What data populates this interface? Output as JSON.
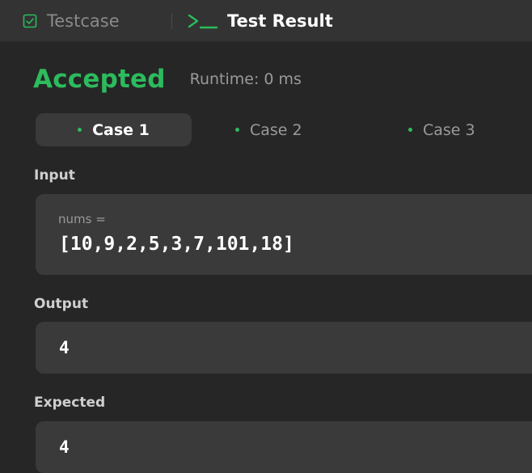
{
  "tabs": {
    "testcase_label": "Testcase",
    "testcase_icon": "checkbox-icon",
    "result_label": "Test Result",
    "result_icon": "terminal-icon",
    "active_tab": "Test Result"
  },
  "result": {
    "status": "Accepted",
    "runtime": "Runtime: 0 ms"
  },
  "cases": [
    {
      "label": "Case 1",
      "active": true,
      "passed": true
    },
    {
      "label": "Case 2",
      "active": false,
      "passed": true
    },
    {
      "label": "Case 3",
      "active": false,
      "passed": true
    }
  ],
  "input": {
    "label": "Input",
    "param_name": "nums =",
    "param_value": "[10,9,2,5,3,7,101,18]"
  },
  "output": {
    "label": "Output",
    "value": "4"
  },
  "expected": {
    "label": "Expected",
    "value": "4"
  },
  "colors": {
    "accepted": "#2cbb5d",
    "tab_active_icon": "#2cbb5d",
    "background": "#262626",
    "panel": "#3a3a3a"
  }
}
